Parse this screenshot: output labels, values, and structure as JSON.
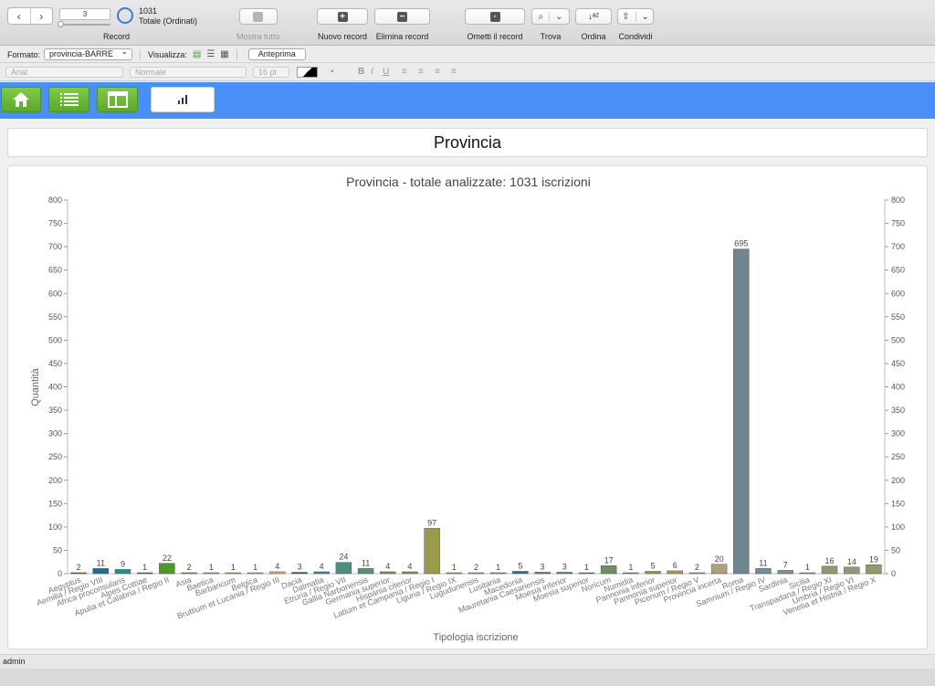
{
  "toolbar": {
    "record_value": "3",
    "record_total": "1031",
    "record_sort": "Totale (Ordinati)",
    "record_label": "Record",
    "show_all": "Mostra tutto",
    "new_record": "Nuovo record",
    "delete_record": "Elimina record",
    "omit_record": "Ometti il record",
    "find": "Trova",
    "sort": "Ordina",
    "share": "Condividi"
  },
  "layoutbar": {
    "format_label": "Formato:",
    "format_value": "provincia-BARRE",
    "view_label": "Visualizza:",
    "preview": "Anteprima"
  },
  "formatbar": {
    "font": "Arial",
    "style": "Normale",
    "size": "16 pt",
    "bold": "B",
    "italic": "I",
    "underline": "U"
  },
  "page": {
    "heading": "Provincia"
  },
  "status": {
    "user": "admin"
  },
  "colors": {
    "blue_bar": "#4a8ff8",
    "green_buttons": "#6cbb38"
  },
  "chart_data": {
    "type": "bar",
    "title": "Provincia - totale analizzate: 1031 iscrizioni",
    "xlabel": "Tipologia iscrizione",
    "ylabel": "Quantità",
    "ylim": [
      0,
      800
    ],
    "yticks": [
      0,
      50,
      100,
      150,
      200,
      250,
      300,
      350,
      400,
      450,
      500,
      550,
      600,
      650,
      700,
      750,
      800
    ],
    "grid": false,
    "categories": [
      "Aegyptus",
      "Aemilia / Regio VIII",
      "Africa proconsularis",
      "Alpes Cottiae",
      "Apulia et Calabria / Regio II",
      "Asia",
      "Baetica",
      "Barbaricum",
      "Belgica",
      "Bruttium et Lucania / Regio III",
      "Dacia",
      "Dalmatia",
      "Etruria / Regio VII",
      "Gallia Narbonensis",
      "Germania superior",
      "Hispania citerior",
      "Latium et Campania / Regio I",
      "Liguria / Regio IX",
      "Lugudunensis",
      "Lusitania",
      "Macedonia",
      "Mauretania Caesariensis",
      "Moesia inferior",
      "Moesia superior",
      "Noricum",
      "Numidia",
      "Pannonia inferior",
      "Pannonia superior",
      "Picenum / Regio V",
      "Provincia incerta",
      "Roma",
      "Samnium / Regio IV",
      "Sardinia",
      "Sicilia",
      "Transpadana / Regio XI",
      "Umbria / Regio VI",
      "Venetia et Histria / Regio X"
    ],
    "values": [
      2,
      11,
      9,
      1,
      22,
      2,
      1,
      1,
      1,
      4,
      3,
      4,
      24,
      11,
      4,
      4,
      97,
      1,
      2,
      1,
      5,
      3,
      3,
      1,
      17,
      1,
      5,
      6,
      2,
      20,
      695,
      11,
      7,
      1,
      16,
      14,
      19
    ],
    "bar_colors": [
      "#1f5f8b",
      "#1f6f8b",
      "#2a8b8b",
      "#555555",
      "#4c9a2a",
      "#8a8a3a",
      "#a8a84a",
      "#b0a040",
      "#c8b050",
      "#d4b060",
      "#2f6f8f",
      "#3a7f9f",
      "#4a8f7f",
      "#5a8f6f",
      "#7a8f5f",
      "#7f8f5f",
      "#9a9a4a",
      "#a0a050",
      "#a8a858",
      "#909050",
      "#2f6f8f",
      "#3f7f8f",
      "#4f7f7f",
      "#5f7f6f",
      "#6f8f5f",
      "#7f8f5f",
      "#a09050",
      "#a89858",
      "#b0a070",
      "#b0a07a",
      "#6f8590",
      "#6f8f9f",
      "#7f8f8f",
      "#8f8f7f",
      "#8f9a70",
      "#8f9a78",
      "#8f9a6f"
    ]
  }
}
